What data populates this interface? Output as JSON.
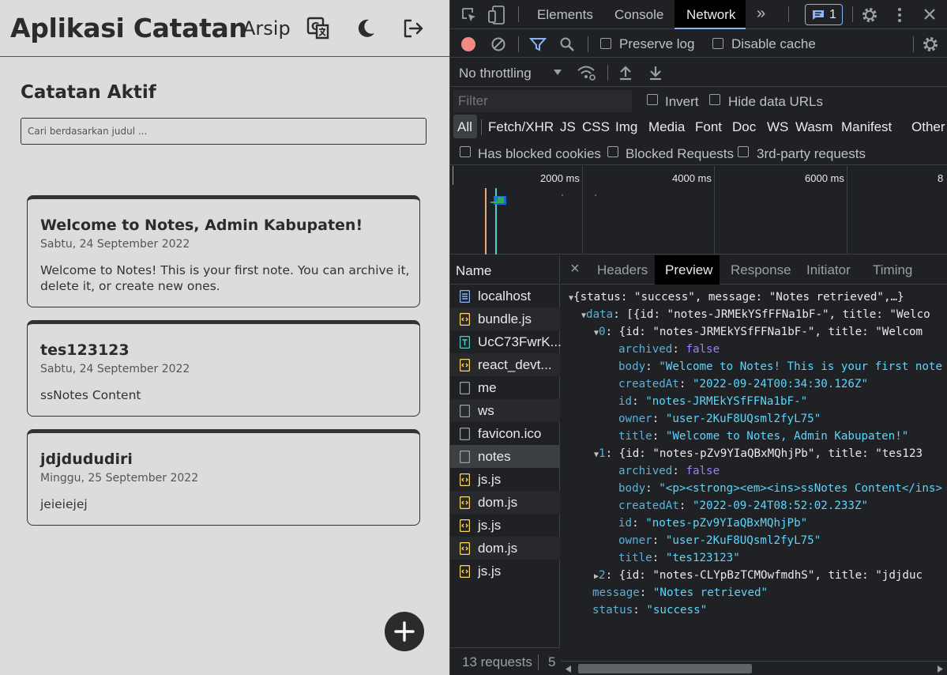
{
  "app": {
    "title": "Aplikasi Catatan",
    "nav_archive": "Arsip",
    "section_title": "Catatan Aktif",
    "search_placeholder": "Cari berdasarkan judul ...",
    "notes": [
      {
        "title": "Welcome to Notes, Admin Kabupaten!",
        "date": "Sabtu, 24 September 2022",
        "body": "Welcome to Notes! This is your first note. You can archive it, delete it, or create new ones."
      },
      {
        "title": "tes123123",
        "date": "Sabtu, 24 September 2022",
        "body": "ssNotes Content"
      },
      {
        "title": "jdjdududiri",
        "date": "Minggu, 25 September 2022",
        "body": "jeieiejej"
      }
    ]
  },
  "devtools": {
    "tabs": [
      "Elements",
      "Console",
      "Network"
    ],
    "active_tab": "Network",
    "more": "»",
    "issues_count": "1",
    "preserve_log": "Preserve log",
    "disable_cache": "Disable cache",
    "throttling": "No throttling",
    "filter_placeholder": "Filter",
    "invert": "Invert",
    "hide_data_urls": "Hide data URLs",
    "type_filters": [
      "All",
      "Fetch/XHR",
      "JS",
      "CSS",
      "Img",
      "Media",
      "Font",
      "Doc",
      "WS",
      "Wasm",
      "Manifest",
      "Other"
    ],
    "blocked_filters": [
      "Has blocked cookies",
      "Blocked Requests",
      "3rd-party requests"
    ],
    "timeline_labels": [
      "2000 ms",
      "4000 ms",
      "6000 ms",
      "8"
    ],
    "name_header": "Name",
    "requests": [
      {
        "name": "localhost",
        "type": "doc"
      },
      {
        "name": "bundle.js",
        "type": "js"
      },
      {
        "name": "UcC73FwrK...",
        "type": "font"
      },
      {
        "name": "react_devt...",
        "type": "js"
      },
      {
        "name": "me",
        "type": "xhr"
      },
      {
        "name": "ws",
        "type": "xhr"
      },
      {
        "name": "favicon.ico",
        "type": "xhr"
      },
      {
        "name": "notes",
        "type": "xhr"
      },
      {
        "name": "js.js",
        "type": "js"
      },
      {
        "name": "dom.js",
        "type": "js"
      },
      {
        "name": "js.js",
        "type": "js"
      },
      {
        "name": "dom.js",
        "type": "js"
      },
      {
        "name": "js.js",
        "type": "js"
      }
    ],
    "requests_count": "13 requests",
    "requests_count_extra": "5",
    "detail_tabs": [
      "Headers",
      "Preview",
      "Response",
      "Initiator",
      "Timing"
    ],
    "active_detail_tab": "Preview",
    "close": "×",
    "preview": {
      "root": "{status: \"success\", message: \"Notes retrieved\",…}",
      "data_key": "data",
      "data_summary": "[{id: \"notes-JRMEkYSfFFNa1bF-\", title: \"Welco",
      "item0_summary": "{id: \"notes-JRMEkYSfFFNa1bF-\", title: \"Welcom",
      "item0": {
        "archived": "false",
        "body": "\"Welcome to Notes! This is your first note",
        "createdAt": "\"2022-09-24T00:34:30.126Z\"",
        "id": "\"notes-JRMEkYSfFFNa1bF-\"",
        "owner": "\"user-2KuF8UQsml2fyL75\"",
        "title": "\"Welcome to Notes, Admin Kabupaten!\""
      },
      "item1_summary": "{id: \"notes-pZv9YIaQBxMQhjPb\", title: \"tes123",
      "item1": {
        "archived": "false",
        "body": "\"<p><strong><em><ins>ssNotes Content</ins>",
        "createdAt": "\"2022-09-24T08:52:02.233Z\"",
        "id": "\"notes-pZv9YIaQBxMQhjPb\"",
        "owner": "\"user-2KuF8UQsml2fyL75\"",
        "title": "\"tes123123\""
      },
      "item2_summary": "{id: \"notes-CLYpBzTCMOwfmdhS\", title: \"jdjduc",
      "message": "\"Notes retrieved\"",
      "status": "\"success\""
    }
  }
}
